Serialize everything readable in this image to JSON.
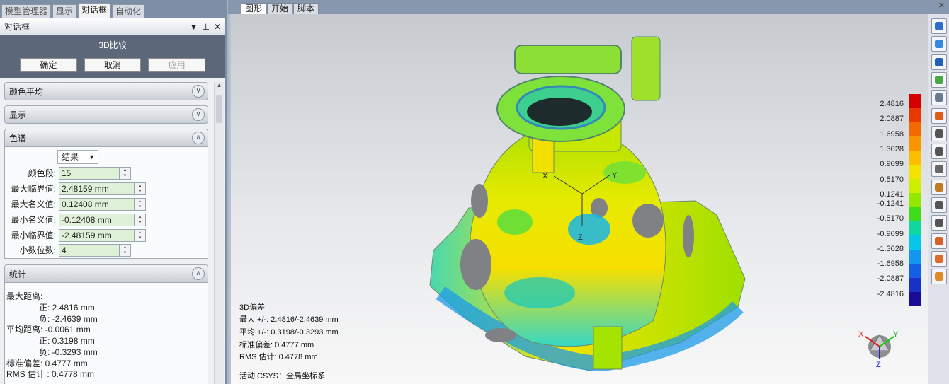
{
  "top_tabs": [
    "模型管理器",
    "显示",
    "对话框",
    "自动化"
  ],
  "active_top_tab": 2,
  "panel": {
    "title": "对话框",
    "controls": [
      "▼",
      "⊥",
      "✕"
    ],
    "dialog_title": "3D比较",
    "buttons": {
      "ok": "确定",
      "cancel": "取消",
      "apply": "应用"
    }
  },
  "sections": {
    "color_avg": "颜色平均",
    "display": "显示",
    "spectrum": "色谱",
    "stats": "统计"
  },
  "spectrum": {
    "mode": "结果",
    "rows": [
      {
        "label": "颜色段:",
        "value": "15"
      },
      {
        "label": "最大临界值:",
        "value": "2.48159 mm"
      },
      {
        "label": "最大名义值:",
        "value": "0.12408 mm"
      },
      {
        "label": "最小名义值:",
        "value": "-0.12408 mm"
      },
      {
        "label": "最小临界值:",
        "value": "-2.48159 mm"
      },
      {
        "label": "小数位数:",
        "value": "4"
      }
    ]
  },
  "stats": {
    "max_title": "最大距离:",
    "max_pos": "正: 2.4816 mm",
    "max_neg": "负: -2.4639 mm",
    "avg_title": "平均距离: -0.0061 mm",
    "avg_pos": "正: 0.3198 mm",
    "avg_neg": "负: -0.3293 mm",
    "std": "标准偏差: 0.4777 mm",
    "rms": "RMS 估计 : 0.4778 mm"
  },
  "view_tabs": [
    "图形",
    "开始",
    "脚本"
  ],
  "active_view_tab": 0,
  "view_close": "✕",
  "legend": {
    "labels": [
      "2.4816",
      "2.0887",
      "1.6958",
      "1.3028",
      "0.9099",
      "0.5170",
      "0.1241",
      "-0.1241",
      "-0.5170",
      "-0.9099",
      "-1.3028",
      "-1.6958",
      "-2.0887",
      "-2.4816"
    ],
    "colors": [
      "#d40000",
      "#e83a00",
      "#f26a00",
      "#f89500",
      "#fbbf00",
      "#f4e300",
      "#cfee00",
      "#93e800",
      "#3fdc1c",
      "#10d6a2",
      "#08c6e8",
      "#1296f0",
      "#1460e4",
      "#1832c6",
      "#1a0b96"
    ]
  },
  "info": {
    "title": "3D偏差",
    "max": "最大 +/-: 2.4816/-2.4639 mm",
    "avg": "平均 +/-: 0.3198/-0.3293 mm",
    "std": "标准偏差: 0.4777 mm",
    "rms": "RMS 估计: 0.4778 mm",
    "csys": "活动 CSYS：全局坐标系"
  },
  "axes": {
    "x": "X",
    "y": "Y",
    "z": "Z"
  },
  "gizmo_axes": {
    "x": "X",
    "y": "Y",
    "z": "Z"
  },
  "toolbar_icons": [
    "window-icon",
    "rotate-icon",
    "view-icon",
    "layers-icon",
    "zoom-fit-icon",
    "color-ring-icon",
    "select-rect-icon",
    "select-lasso-icon",
    "line-icon",
    "curve-icon",
    "select-box-icon",
    "polygon-icon",
    "cube-icon",
    "cube-icon",
    "cube-icon"
  ],
  "accent_colors": {
    "panel_dark": "#5c6879",
    "field_bg": "#dff0d8"
  }
}
